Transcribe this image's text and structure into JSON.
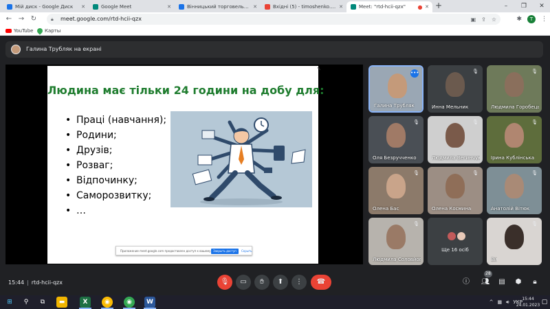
{
  "browser": {
    "tabs": [
      {
        "label": "Мій диск - Google Диск",
        "favicon_color": "#1a73e8",
        "active": false
      },
      {
        "label": "Google Meet",
        "favicon_color": "#00897b",
        "active": false
      },
      {
        "label": "Вінницький торговельно-еконо",
        "favicon_color": "#1a73e8",
        "active": false
      },
      {
        "label": "Вхідні (5) - timoshenko.natalia@",
        "favicon_color": "#ea4335",
        "active": false
      },
      {
        "label": "Meet: \"rtd-hcii-qzx\"",
        "favicon_color": "#00897b",
        "active": true
      }
    ],
    "new_tab_label": "+",
    "url": "meet.google.com/rtd-hcii-qzx",
    "profile_initial": "T",
    "bookmarks": [
      {
        "label": "YouTube",
        "icon": "youtube-icon"
      },
      {
        "label": "Карты",
        "icon": "maps-icon"
      }
    ]
  },
  "meet": {
    "presenter_banner": "Галина Трубляк на екрані",
    "slide": {
      "title": "Людина має тільки 24 години на добу для:",
      "bullets": [
        "Праці (навчання);",
        "Родини;",
        "Друзів;",
        "Розваг;",
        "Відпочинку;",
        "Саморозвитку;",
        "…"
      ],
      "share_bar": {
        "message": "Приложение meet.google.com предоставлен доступ к вашему экрану.",
        "stop_label": "Закрыть доступ",
        "hide_label": "Скрыть"
      }
    },
    "participants": [
      {
        "name": "Галина Трубляк",
        "muted": false,
        "speaking": true,
        "bg": "#9aa7b4",
        "face": "#c49a7a"
      },
      {
        "name": "Инна Мельник",
        "muted": true,
        "speaking": false,
        "bg": "#3c4043",
        "face": "#6b5a4e"
      },
      {
        "name": "Людмила Горобець",
        "muted": true,
        "speaking": false,
        "bg": "#6e7a5a",
        "face": "#8a6f5c"
      },
      {
        "name": "Оля Безручченко",
        "muted": true,
        "speaking": false,
        "bg": "#4a4f55",
        "face": "#a07a66"
      },
      {
        "name": "Людмила Вегинчук",
        "muted": true,
        "speaking": false,
        "bg": "#cfcfcf",
        "face": "#7a5a4a"
      },
      {
        "name": "Ірина Кублінська",
        "muted": true,
        "speaking": false,
        "bg": "#5e6d3c",
        "face": "#b08670"
      },
      {
        "name": "Олена Бас",
        "muted": true,
        "speaking": false,
        "bg": "#8c7a6a",
        "face": "#c9a48a"
      },
      {
        "name": "Олена Космина",
        "muted": true,
        "speaking": false,
        "bg": "#9c8e84",
        "face": "#8f6e58"
      },
      {
        "name": "Анатолій Вітюк",
        "muted": true,
        "speaking": false,
        "bg": "#7e8f96",
        "face": "#a98a76"
      },
      {
        "name": "Людмила Соловйова",
        "muted": true,
        "speaking": false,
        "bg": "#b7b3ad",
        "face": "#9a7a66"
      },
      {
        "name": "Ще 16 осіб",
        "more": true,
        "speaking": false,
        "bg": "#3c4043",
        "face": "#c25a5a"
      },
      {
        "name": "Ви",
        "muted": true,
        "speaking": false,
        "bg": "#d9d5d2",
        "face": "#3a2f2a"
      }
    ],
    "bottom": {
      "time": "15:44",
      "meeting_code": "rtd-hcii-qzx",
      "people_count": "28"
    }
  },
  "taskbar": {
    "language": "УКР",
    "time": "15:44",
    "date": "24.01.2023"
  }
}
